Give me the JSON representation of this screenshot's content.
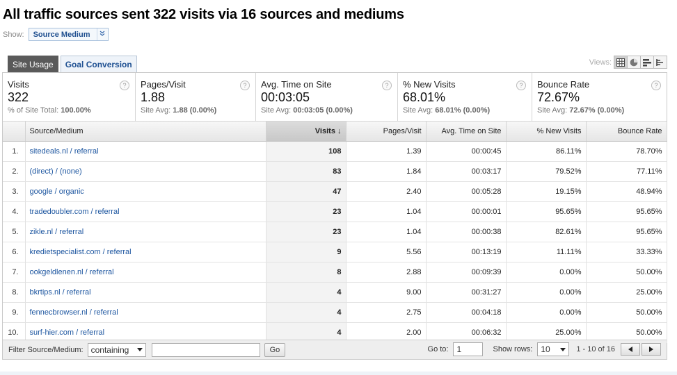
{
  "title": "All traffic sources sent 322 visits via 16 sources and mediums",
  "show": {
    "label": "Show:",
    "value": "Source Medium",
    "chevron": "chevron-down-icon"
  },
  "tabs": [
    {
      "label": "Site Usage",
      "active": true
    },
    {
      "label": "Goal Conversion",
      "active": false
    }
  ],
  "views": {
    "label": "Views:",
    "buttons": [
      "table-view-icon",
      "pie-view-icon",
      "bar-view-icon",
      "pivot-view-icon"
    ]
  },
  "summary": [
    {
      "label": "Visits",
      "value": "322",
      "sub_label": "% of Site Total:",
      "sub_value": "100.00%"
    },
    {
      "label": "Pages/Visit",
      "value": "1.88",
      "sub_label": "Site Avg:",
      "sub_value": "1.88 (0.00%)"
    },
    {
      "label": "Avg. Time on Site",
      "value": "00:03:05",
      "sub_label": "Site Avg:",
      "sub_value": "00:03:05 (0.00%)"
    },
    {
      "label": "% New Visits",
      "value": "68.01%",
      "sub_label": "Site Avg:",
      "sub_value": "68.01% (0.00%)"
    },
    {
      "label": "Bounce Rate",
      "value": "72.67%",
      "sub_label": "Site Avg:",
      "sub_value": "72.67% (0.00%)"
    }
  ],
  "help_icon": "?",
  "table": {
    "headers": [
      "Source/Medium",
      "Visits",
      "Pages/Visit",
      "Avg. Time on Site",
      "% New Visits",
      "Bounce Rate"
    ],
    "sort_arrow": "↓",
    "rows": [
      [
        "1.",
        "sitedeals.nl / referral",
        "108",
        "1.39",
        "00:00:45",
        "86.11%",
        "78.70%"
      ],
      [
        "2.",
        "(direct) / (none)",
        "83",
        "1.84",
        "00:03:17",
        "79.52%",
        "77.11%"
      ],
      [
        "3.",
        "google / organic",
        "47",
        "2.40",
        "00:05:28",
        "19.15%",
        "48.94%"
      ],
      [
        "4.",
        "tradedoubler.com / referral",
        "23",
        "1.04",
        "00:00:01",
        "95.65%",
        "95.65%"
      ],
      [
        "5.",
        "zikle.nl / referral",
        "23",
        "1.04",
        "00:00:38",
        "82.61%",
        "95.65%"
      ],
      [
        "6.",
        "kredietspecialist.com / referral",
        "9",
        "5.56",
        "00:13:19",
        "11.11%",
        "33.33%"
      ],
      [
        "7.",
        "ookgeldlenen.nl / referral",
        "8",
        "2.88",
        "00:09:39",
        "0.00%",
        "50.00%"
      ],
      [
        "8.",
        "bkrtips.nl / referral",
        "4",
        "9.00",
        "00:31:27",
        "0.00%",
        "25.00%"
      ],
      [
        "9.",
        "fennecbrowser.nl / referral",
        "4",
        "2.75",
        "00:04:18",
        "0.00%",
        "50.00%"
      ],
      [
        "10.",
        "surf-hier.com / referral",
        "4",
        "2.00",
        "00:06:32",
        "25.00%",
        "50.00%"
      ]
    ]
  },
  "filter": {
    "label": "Filter Source/Medium:",
    "mode": "containing",
    "input_value": "",
    "go_label": "Go",
    "goto_label": "Go to:",
    "goto_value": "1",
    "rows_label": "Show rows:",
    "rows_value": "10",
    "range": "1 - 10 of 16"
  }
}
